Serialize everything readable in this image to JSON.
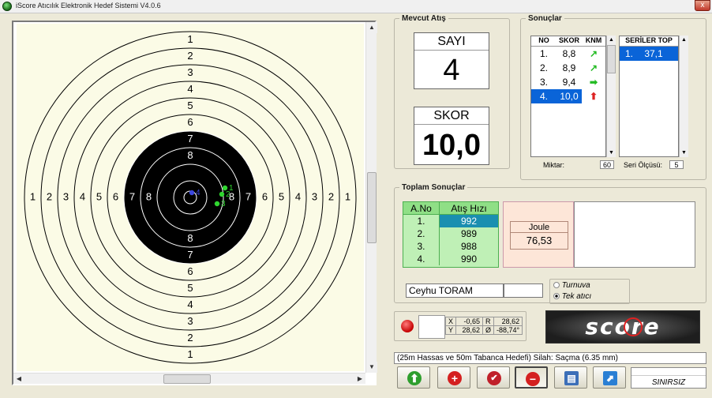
{
  "window": {
    "title": "iScore Atıcılık Elektronik Hedef Sistemi V4.0.6",
    "close_glyph": "x"
  },
  "target": {
    "ring_labels_top": [
      "1",
      "2",
      "3",
      "4",
      "5",
      "6",
      "7",
      "8"
    ],
    "ring_labels_bottom": [
      "8",
      "7",
      "6",
      "5",
      "4",
      "3",
      "2",
      "1"
    ],
    "ring_labels_left": [
      "1",
      "2",
      "3",
      "4",
      "5",
      "6",
      "7",
      "8"
    ],
    "ring_labels_right": [
      "8",
      "7",
      "6",
      "5",
      "4",
      "3",
      "2",
      "1"
    ],
    "shots": [
      {
        "label": "1",
        "color": "#2fd62f"
      },
      {
        "label": "2",
        "color": "#2fd62f"
      },
      {
        "label": "3",
        "color": "#2fd62f"
      },
      {
        "label": "4",
        "color": "#3b47e0"
      }
    ],
    "colors": {
      "paper": "#fbfbe6",
      "black": "#000000",
      "ring_light": "#ffffff"
    }
  },
  "mevcut_atis": {
    "legend": "Mevcut Atış",
    "sayi_label": "SAYI",
    "sayi_value": "4",
    "skor_label": "SKOR",
    "skor_value": "10,0"
  },
  "sonuclar": {
    "legend": "Sonuçlar",
    "headers": {
      "no": "NO",
      "skor": "SKOR",
      "knm": "KNM",
      "seriler": "SERİLER TOP"
    },
    "rows": [
      {
        "no": "1.",
        "skor": "8,8",
        "knm": "↗",
        "knm_color": "#22bb22"
      },
      {
        "no": "2.",
        "skor": "8,9",
        "knm": "↗",
        "knm_color": "#22bb22"
      },
      {
        "no": "3.",
        "skor": "9,4",
        "knm": "➡",
        "knm_color": "#22bb22"
      },
      {
        "no": "4.",
        "skor": "10,0",
        "knm": "⬆",
        "knm_color": "#dd2222"
      }
    ],
    "series": [
      {
        "no": "1.",
        "total": "37,1"
      }
    ],
    "miktar_label": "Miktar:",
    "miktar_value": "60",
    "seri_olcusu_label": "Seri Ölçüsü:",
    "seri_olcusu_value": "5"
  },
  "toplam_sonuclar": {
    "legend": "Toplam Sonuçlar",
    "headers": {
      "a_no": "A.No",
      "atis_hizi": "Atış Hızı"
    },
    "rows": [
      {
        "no": "1.",
        "speed": "992"
      },
      {
        "no": "2.",
        "speed": "989"
      },
      {
        "no": "3.",
        "speed": "988"
      },
      {
        "no": "4.",
        "speed": "990"
      }
    ],
    "joule_label": "Joule",
    "joule_value": "76,53",
    "shooter_name": "Ceyhu TORAM",
    "mode_turnuva": "Turnuva",
    "mode_tek": "Tek atıcı",
    "selected_mode": "Tek atıcı"
  },
  "coords": {
    "x_label": "X",
    "x_value": "-0,65",
    "y_label": "Y",
    "y_value": "28,62",
    "r_label": "R",
    "r_value": "28,62",
    "phi_label": "Ø",
    "phi_value": "-88,74°"
  },
  "logo_text": "score",
  "status_line": "(25m Hassas ve 50m Tabanca Hedefi) Silah: Saçma (6.35 mm)",
  "sinirsiz": "SINIRSIZ",
  "toolbar": [
    {
      "name": "upload-button",
      "icon": "upload-icon",
      "glyph": "⬆",
      "color": "#2e9e2e"
    },
    {
      "name": "add-button",
      "icon": "plus-icon",
      "glyph": "+",
      "color": "#d42020"
    },
    {
      "name": "confirm-button",
      "icon": "check-icon",
      "glyph": "✔",
      "color": "#c0202a"
    },
    {
      "name": "remove-button",
      "icon": "minus-icon",
      "glyph": "−",
      "color": "#d42020"
    },
    {
      "name": "print-button",
      "icon": "printer-icon",
      "glyph": "▤",
      "color": "#3c6fb8"
    },
    {
      "name": "export-button",
      "icon": "export-icon",
      "glyph": "⬈",
      "color": "#2a7fd4"
    }
  ]
}
